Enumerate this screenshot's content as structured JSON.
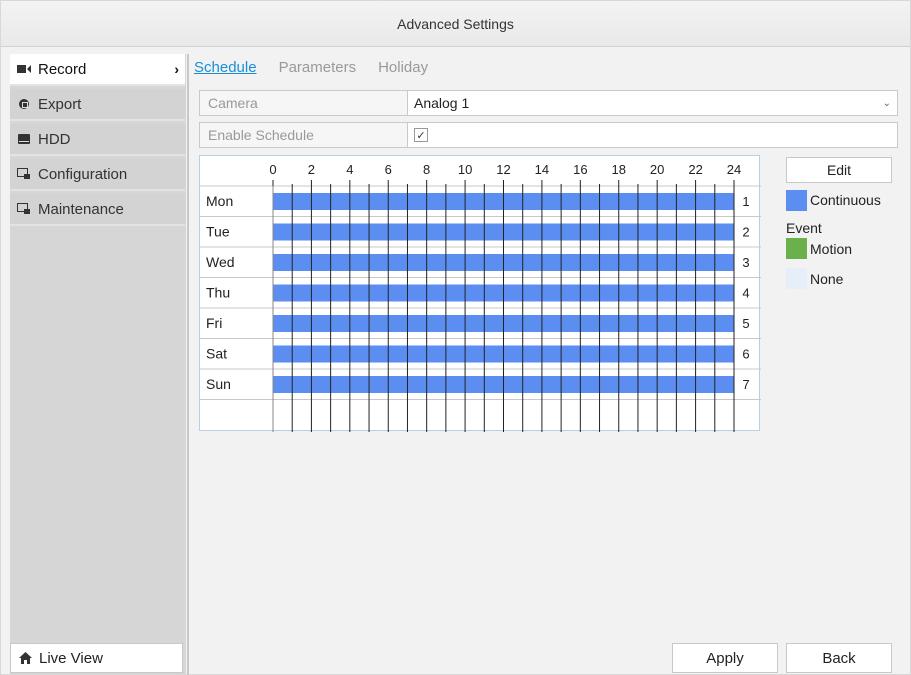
{
  "title": "Advanced Settings",
  "sidebar": {
    "items": [
      {
        "label": "Record",
        "icon": "video-camera-icon",
        "active": true
      },
      {
        "label": "Export",
        "icon": "export-icon",
        "active": false
      },
      {
        "label": "HDD",
        "icon": "hdd-icon",
        "active": false
      },
      {
        "label": "Configuration",
        "icon": "configuration-icon",
        "active": false
      },
      {
        "label": "Maintenance",
        "icon": "maintenance-icon",
        "active": false
      }
    ],
    "live_view": "Live View"
  },
  "tabs": [
    {
      "label": "Schedule",
      "active": true
    },
    {
      "label": "Parameters",
      "active": false
    },
    {
      "label": "Holiday",
      "active": false
    }
  ],
  "form": {
    "camera_label": "Camera",
    "camera_value": "Analog 1",
    "enable_label": "Enable Schedule",
    "enable_checked": true
  },
  "schedule": {
    "hours": [
      "0",
      "2",
      "4",
      "6",
      "8",
      "10",
      "12",
      "14",
      "16",
      "18",
      "20",
      "22",
      "24"
    ],
    "days": [
      {
        "label": "Mon",
        "index": "1",
        "mode": "Continuous",
        "start": 0,
        "end": 24
      },
      {
        "label": "Tue",
        "index": "2",
        "mode": "Continuous",
        "start": 0,
        "end": 24
      },
      {
        "label": "Wed",
        "index": "3",
        "mode": "Continuous",
        "start": 0,
        "end": 24
      },
      {
        "label": "Thu",
        "index": "4",
        "mode": "Continuous",
        "start": 0,
        "end": 24
      },
      {
        "label": "Fri",
        "index": "5",
        "mode": "Continuous",
        "start": 0,
        "end": 24
      },
      {
        "label": "Sat",
        "index": "6",
        "mode": "Continuous",
        "start": 0,
        "end": 24
      },
      {
        "label": "Sun",
        "index": "7",
        "mode": "Continuous",
        "start": 0,
        "end": 24
      }
    ]
  },
  "legend": {
    "edit": "Edit",
    "continuous": "Continuous",
    "event": "Event",
    "motion": "Motion",
    "none": "None"
  },
  "colors": {
    "continuous": "#5b8ef0",
    "motion": "#6ab04c",
    "none": "#e6eef9",
    "accent": "#1a8fd8"
  },
  "buttons": {
    "apply": "Apply",
    "back": "Back"
  }
}
